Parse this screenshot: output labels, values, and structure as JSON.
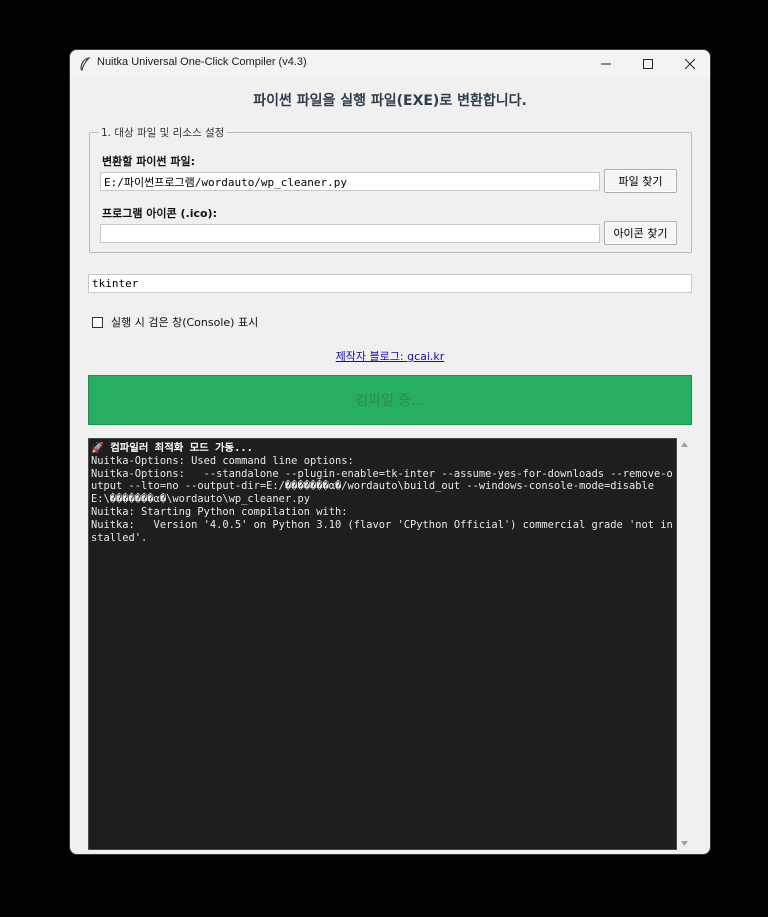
{
  "window": {
    "title": "Nuitka Universal One-Click Compiler (v4.3)"
  },
  "header": {
    "heading": "파이썬 파일을 실행 파일(EXE)로 변환합니다."
  },
  "file_group": {
    "legend": "1. 대상 파일 및 리소스 설정",
    "source_label": "변환할 파이썬 파일:",
    "source_value": "E:/파이썬프로그램/wordauto/wp_cleaner.py",
    "source_button": "파일 찾기",
    "icon_label": "프로그램 아이콘 (.ico):",
    "icon_value": "",
    "icon_button": "아이콘 찾기"
  },
  "plugins": {
    "value": "tkinter"
  },
  "options": {
    "console_checkbox_label": "실행 시 검은 창(Console) 표시",
    "console_checked": false
  },
  "footer": {
    "blog_link": "제작자 블로그: gcai.kr"
  },
  "compile": {
    "button_label": "컴파일 중..."
  },
  "console": {
    "lines": [
      "🚀 컴파일러 최적화 모드 가동...",
      "Nuitka-Options: Used command line options:",
      "Nuitka-Options:   --standalone --plugin-enable=tk-inter --assume-yes-for-downloads --remove-output --lto=no --output-dir=E:/�������α׷�/wordauto\\build_out --windows-console-mode=disable E:\\�������α׷�\\wordauto\\wp_cleaner.py",
      "Nuitka: Starting Python compilation with:",
      "Nuitka:   Version '4.0.5' on Python 3.10 (flavor 'CPython Official') commercial grade 'not installed'."
    ]
  },
  "colors": {
    "compile_button": "#27ae60",
    "console_bg": "#1e1e1e",
    "heading": "#2c3e50",
    "link": "#1a0dab"
  }
}
